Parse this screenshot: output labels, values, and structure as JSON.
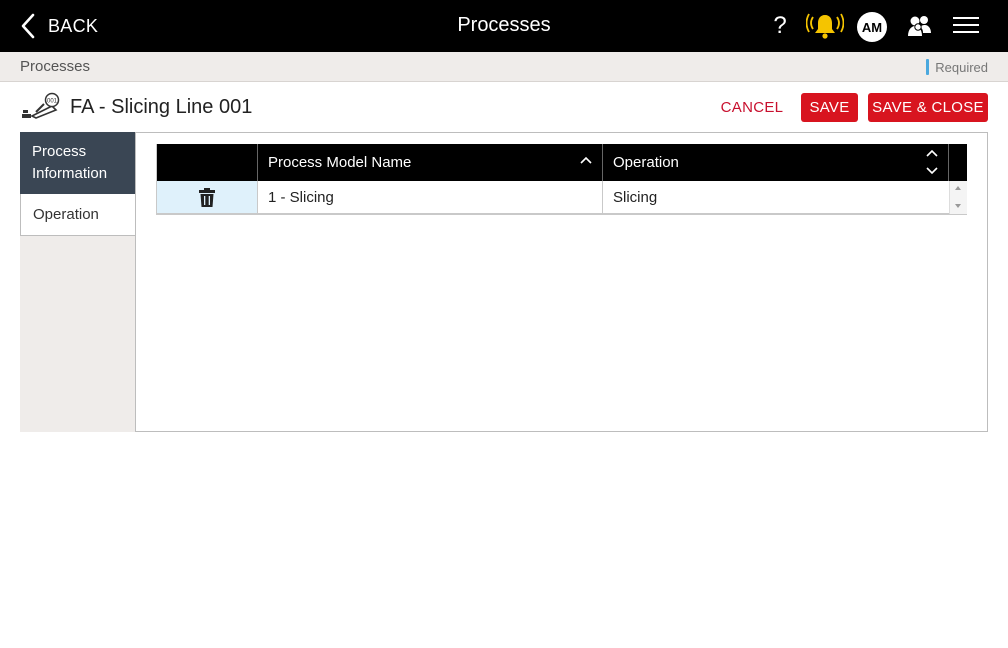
{
  "topbar": {
    "back_label": "BACK",
    "title": "Processes",
    "help_glyph": "?",
    "user_initials": "AM",
    "icons": [
      "chevron-left-icon",
      "help-icon",
      "bell-icon",
      "users-icon",
      "hamburger-menu-icon"
    ],
    "bell_color": "#f5c400"
  },
  "breadcrumb": {
    "current": "Processes",
    "required_label": "Required",
    "required_color": "#4aa8de"
  },
  "record": {
    "icon": "process-machine-icon",
    "title": "FA - Slicing Line 001"
  },
  "actions": {
    "cancel_label": "CANCEL",
    "save_label": "SAVE",
    "save_close_label": "SAVE & CLOSE",
    "accent_color": "#d8141f"
  },
  "sidebar": {
    "items": [
      {
        "label": "Process Information",
        "active": true
      },
      {
        "label": "Operation",
        "active": false
      }
    ]
  },
  "grid": {
    "columns": [
      "Process Model Name",
      "Operation"
    ],
    "rows": [
      {
        "process_model_name": "1 - Slicing",
        "operation": "Slicing"
      }
    ],
    "row_action_icon": "trash-icon"
  }
}
